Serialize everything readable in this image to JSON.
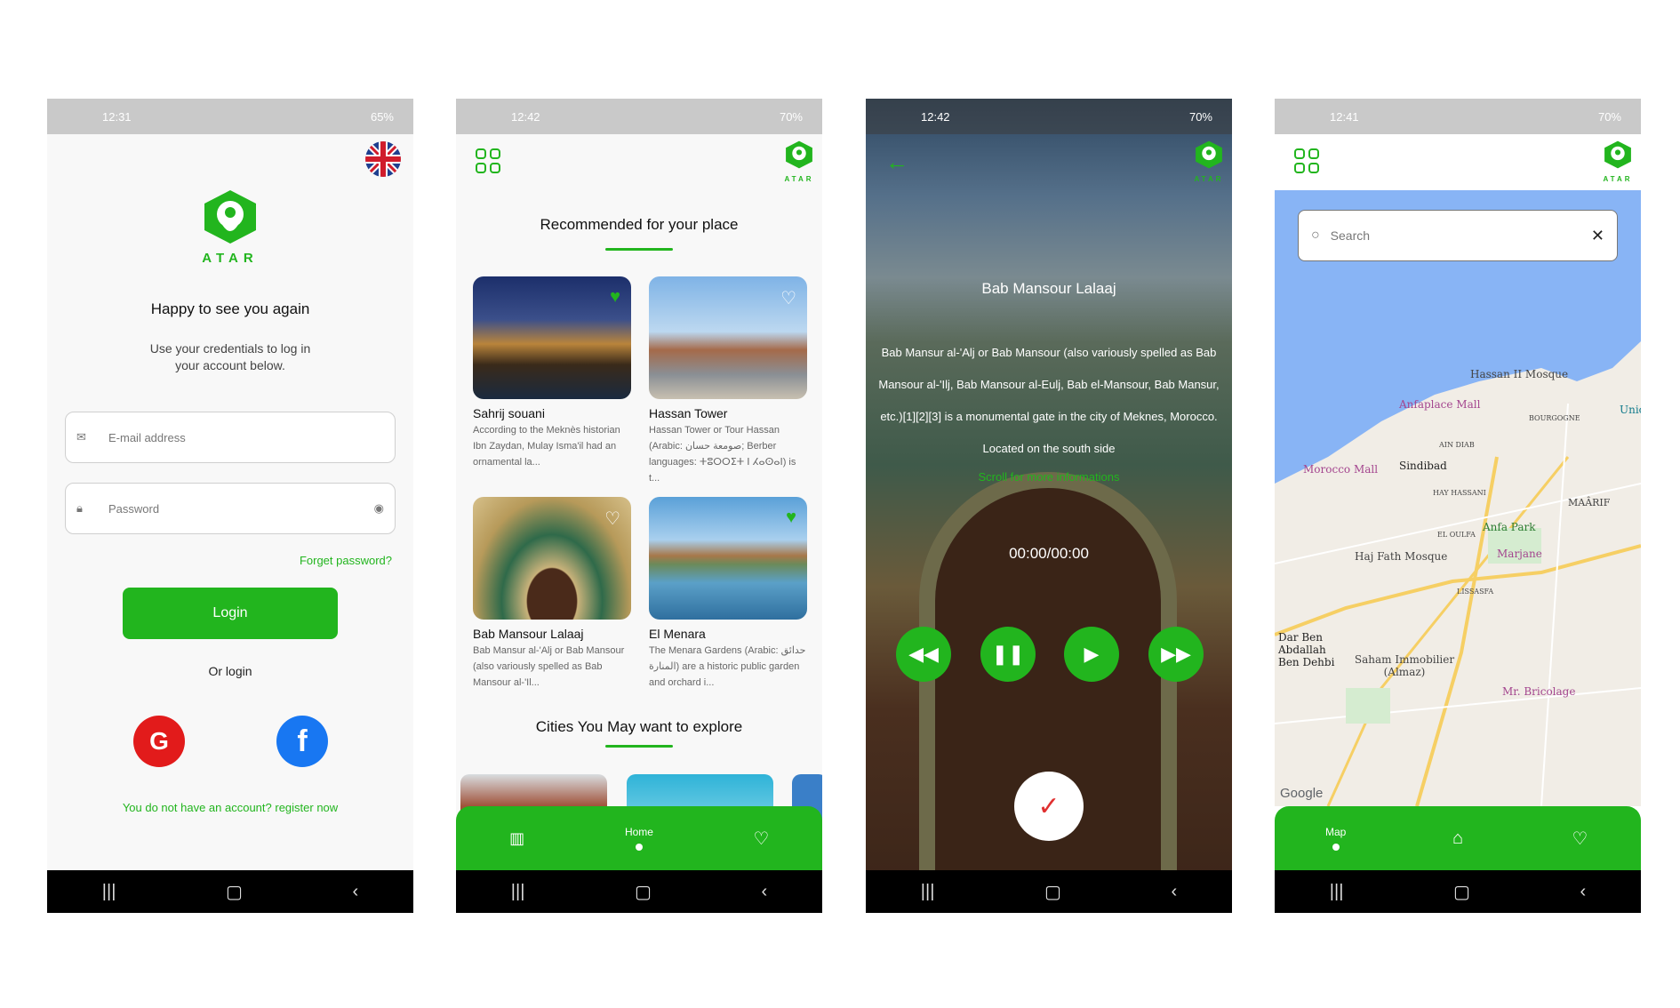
{
  "common": {
    "logo_text": "ATAR",
    "accent": "#22b51e"
  },
  "screen1": {
    "status": {
      "time": "12:31",
      "right": "65%"
    },
    "welcome": "Happy to see you again",
    "subtitle_line1": "Use your credentials to log in",
    "subtitle_line2": "your account below.",
    "email_placeholder": "E-mail address",
    "password_placeholder": "Password",
    "forgot": "Forget password?",
    "login": "Login",
    "or_login": "Or login",
    "google": "G",
    "facebook": "f",
    "register": "You do not have an account? register now"
  },
  "screen2": {
    "status": {
      "time": "12:42",
      "right": "70%"
    },
    "recommended_title": "Recommended for your place",
    "cards": [
      {
        "name": "Sahrij souani",
        "desc": "According to the Meknès historian Ibn Zaydan, Mulay Isma'il had an ornamental la...",
        "fav": true
      },
      {
        "name": "Hassan Tower",
        "desc": "Hassan Tower or Tour Hassan (Arabic: صومعة حسان; Berber languages: ⵜⵓⵔⵔⵉⵜ ⵏ ⵃⴰⵙⴰⵏ) is t...",
        "fav": false
      },
      {
        "name": "Bab Mansour Lalaaj",
        "desc": "Bab Mansur al-'Alj or Bab Mansour (also variously spelled as Bab Mansour al-'Il...",
        "fav": false
      },
      {
        "name": "El Menara",
        "desc": "The Menara Gardens (Arabic: حدائق المنارة) are a historic public garden and orchard i...",
        "fav": true
      }
    ],
    "cities_title": "Cities You May want to explore",
    "nav": {
      "home": "Home"
    }
  },
  "screen3": {
    "status": {
      "time": "12:42",
      "right": "70%"
    },
    "title": "Bab Mansour Lalaaj",
    "description": "Bab Mansur al-'Alj or Bab Mansour (also variously spelled as Bab Mansour al-'Ilj, Bab Mansour al-Eulj, Bab el-Mansour, Bab Mansur, etc.)[1][2][3] is a monumental gate in the city of Meknes, Morocco. Located on the south side",
    "scroll_hint": "Scroll for more informations",
    "timer": "00:00/00:00"
  },
  "screen4": {
    "status": {
      "time": "12:41",
      "right": "70%"
    },
    "search_placeholder": "Search",
    "nav": {
      "map": "Map"
    },
    "map_labels": [
      "Hassan II Mosque",
      "Anfaplace Mall",
      "BOURGOGNE",
      "Morocco Mall",
      "Sindibad",
      "AIN DIAB",
      "HAY HASSANI",
      "Anfa Park",
      "MAÂRIF",
      "EL OULFA",
      "Haj Fath Mosque",
      "Marjane",
      "LISSASFA",
      "Dar Ben Abdallah Ben Dehbi",
      "Saham Immobilier (Almaz)",
      "Mr. Bricolage",
      "Google",
      "Unic"
    ]
  }
}
